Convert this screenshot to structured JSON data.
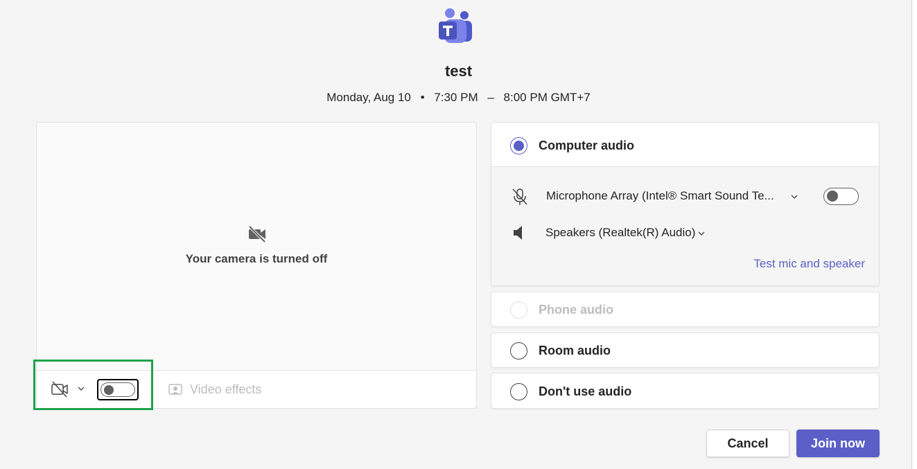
{
  "meeting": {
    "title": "test",
    "date": "Monday, Aug 10",
    "start_time": "7:30 PM",
    "end_time": "8:00 PM GMT+7",
    "bullet": "•",
    "dash": "–"
  },
  "camera": {
    "status_text": "Your camera is turned off",
    "toggle_on": false,
    "video_effects_label": "Video effects"
  },
  "audio": {
    "options": [
      {
        "label": "Computer audio",
        "selected": true,
        "disabled": false
      },
      {
        "label": "Phone audio",
        "selected": false,
        "disabled": true
      },
      {
        "label": "Room audio",
        "selected": false,
        "disabled": false
      },
      {
        "label": "Don't use audio",
        "selected": false,
        "disabled": false
      }
    ],
    "microphone": "Microphone Array (Intel® Smart Sound Te...",
    "mic_on": false,
    "speakers": "Speakers (Realtek(R) Audio)",
    "test_link": "Test mic and speaker"
  },
  "buttons": {
    "cancel": "Cancel",
    "join": "Join now"
  },
  "colors": {
    "accent": "#5b5fc7",
    "highlight": "#1fa24a",
    "background": "#f5f5f5"
  },
  "icons": {
    "logo": "teams-logo-icon",
    "camera_off": "camera-off-icon",
    "mic_off": "mic-off-icon",
    "speaker": "speaker-icon",
    "video_effects": "video-effects-icon",
    "chevron": "chevron-down-icon"
  }
}
